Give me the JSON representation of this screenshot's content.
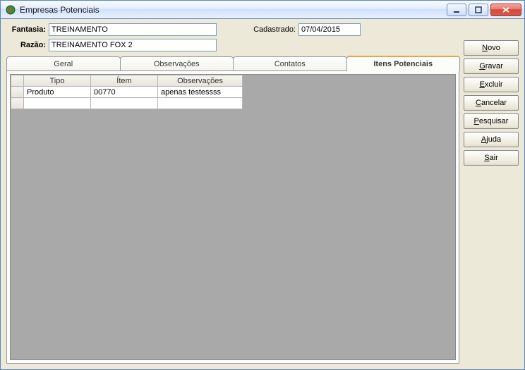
{
  "window": {
    "title": "Empresas Potenciais"
  },
  "header": {
    "labels": {
      "fantasia": "Fantasia:",
      "cadastrado": "Cadastrado:",
      "razao": "Razão:"
    },
    "fields": {
      "fantasia": "TREINAMENTO",
      "cadastrado": "07/04/2015",
      "razao": "TREINAMENTO FOX 2"
    }
  },
  "tabs": {
    "items": [
      {
        "label": "Geral"
      },
      {
        "label": "Observações"
      },
      {
        "label": "Contatos"
      },
      {
        "label": "Itens Potenciais"
      }
    ],
    "activeIndex": 3
  },
  "grid": {
    "columns": {
      "tipo": "Tipo",
      "item": "Ítem",
      "observacoes": "Observações"
    },
    "rows": [
      {
        "tipo": "Produto",
        "item": "00770",
        "observacoes": "apenas testessss"
      },
      {
        "tipo": "",
        "item": "",
        "observacoes": ""
      }
    ]
  },
  "buttons": {
    "novo": {
      "pre": "",
      "k": "N",
      "post": "ovo"
    },
    "gravar": {
      "pre": "",
      "k": "G",
      "post": "ravar"
    },
    "excluir": {
      "pre": "",
      "k": "E",
      "post": "xcluir"
    },
    "cancelar": {
      "pre": "",
      "k": "C",
      "post": "ancelar"
    },
    "pesquisar": {
      "pre": "",
      "k": "P",
      "post": "esquisar"
    },
    "ajuda": {
      "pre": "",
      "k": "A",
      "post": "juda"
    },
    "sair": {
      "pre": "",
      "k": "S",
      "post": "air"
    }
  }
}
